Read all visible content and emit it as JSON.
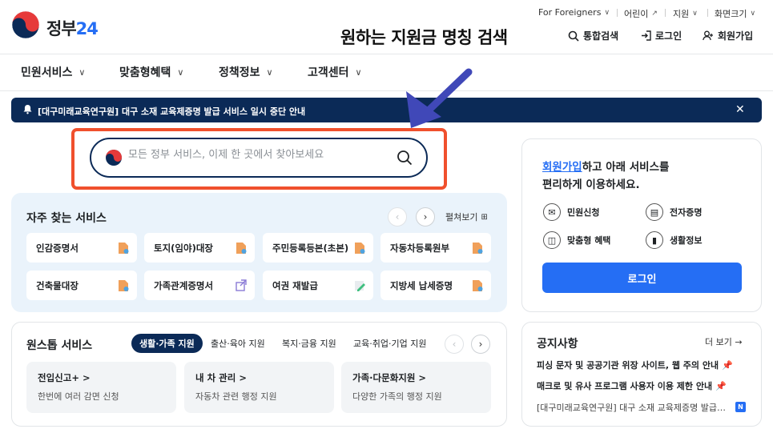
{
  "brand": {
    "name": "정부",
    "num": "24"
  },
  "utility": [
    {
      "label": "For Foreigners"
    },
    {
      "label": "어린이"
    },
    {
      "label": "지원"
    },
    {
      "label": "화면크기"
    }
  ],
  "annotation": "원하는 지원금 명칭 검색",
  "actions": {
    "search": "통합검색",
    "login": "로그인",
    "join": "회원가입"
  },
  "gnb": [
    {
      "label": "민원서비스"
    },
    {
      "label": "맞춤형혜택"
    },
    {
      "label": "정책정보"
    },
    {
      "label": "고객센터"
    }
  ],
  "banner": {
    "text": "[대구미래교육연구원] 대구 소재 교육제증명 발급 서비스 일시 중단 안내"
  },
  "search": {
    "placeholder": "모든 정부 서비스, 이제 한 곳에서 찾아보세요"
  },
  "frequent": {
    "title": "자주 찾는 서비스",
    "expand": "펼쳐보기",
    "items": [
      {
        "label": "인감증명서"
      },
      {
        "label": "토지(임야)대장"
      },
      {
        "label": "주민등록등본(초본)"
      },
      {
        "label": "자동차등록원부"
      },
      {
        "label": "건축물대장"
      },
      {
        "label": "가족관계증명서"
      },
      {
        "label": "여권 재발급"
      },
      {
        "label": "지방세 납세증명"
      }
    ]
  },
  "onestop": {
    "title": "원스톱 서비스",
    "tabs": [
      {
        "label": "생활·가족 지원"
      },
      {
        "label": "출산·육아 지원"
      },
      {
        "label": "복지·금융 지원"
      },
      {
        "label": "교육·취업·기업 지원"
      }
    ],
    "cards": [
      {
        "title": "전입신고+ >",
        "desc": "한번에 여러 감면 신청"
      },
      {
        "title": "내 차 관리 >",
        "desc": "자동차 관련 행정 지원"
      },
      {
        "title": "가족·다문화지원 >",
        "desc": "다양한 가족의 행정 지원"
      }
    ]
  },
  "login_card": {
    "link": "회원가입",
    "msg1": "하고 아래 서비스를",
    "msg2": "편리하게 이용하세요.",
    "quick": [
      {
        "label": "민원신청"
      },
      {
        "label": "전자증명"
      },
      {
        "label": "맞춤형 혜택"
      },
      {
        "label": "생활정보"
      }
    ],
    "button": "로그인"
  },
  "notices": {
    "title": "공지사항",
    "more": "더 보기 →",
    "items": [
      {
        "text": "피싱 문자 및 공공기관 위장 사이트, 웹 주의 안내"
      },
      {
        "text": "매크로 및 유사 프로그램 사용자 이용 제한 안내"
      },
      {
        "text": "[대구미래교육연구원] 대구 소재 교육제증명 발급…"
      }
    ],
    "badge": "N"
  },
  "colors": {
    "navy": "#0b2a57",
    "accent": "#256ef4",
    "highlight": "#f0502d"
  }
}
